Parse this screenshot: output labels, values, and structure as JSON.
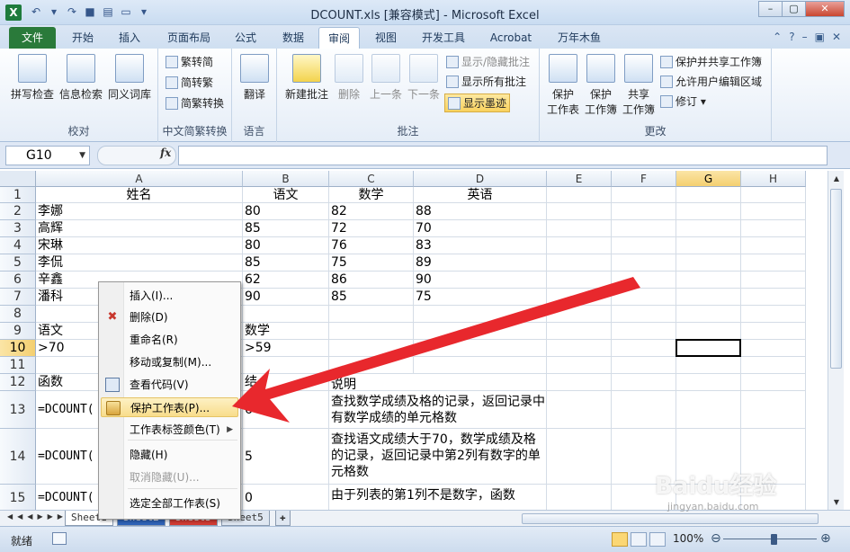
{
  "app": {
    "title": "DCOUNT.xls  [兼容模式] - Microsoft Excel",
    "logo": "X",
    "accent": "#2a7a3a"
  },
  "ribbon_tabs": [
    "文件",
    "开始",
    "插入",
    "页面布局",
    "公式",
    "数据",
    "审阅",
    "视图",
    "开发工具",
    "Acrobat",
    "万年木鱼"
  ],
  "active_tab": "审阅",
  "ribbon": {
    "proofing": {
      "spell": "拼写检查",
      "research": "信息检索",
      "thesaurus": "同义词库",
      "label": "校对"
    },
    "chinese": {
      "to_simplified": "繁转简",
      "to_traditional": "简转繁",
      "convert": "简繁转换",
      "label": "中文简繁转换"
    },
    "language": {
      "translate": "翻译",
      "label": "语言"
    },
    "comments": {
      "new": "新建批注",
      "delete": "删除",
      "prev": "上一条",
      "next": "下一条",
      "show_hide": "显示/隐藏批注",
      "show_all": "显示所有批注",
      "show_ink": "显示墨迹",
      "label": "批注"
    },
    "changes": {
      "protect_sheet_1": "保护",
      "protect_sheet_2": "工作表",
      "protect_book_1": "保护",
      "protect_book_2": "工作簿",
      "share_1": "共享",
      "share_2": "工作簿",
      "protect_share": "保护并共享工作簿",
      "allow_edit": "允许用户编辑区域",
      "track": "修订",
      "label": "更改"
    }
  },
  "formula_bar": {
    "name_box": "G10",
    "fx": "fx",
    "formula": ""
  },
  "columns": [
    "A",
    "B",
    "C",
    "D",
    "E",
    "F",
    "G",
    "H"
  ],
  "selected_column": "G",
  "rows": [
    "1",
    "2",
    "3",
    "4",
    "5",
    "6",
    "7",
    "8",
    "9",
    "10",
    "11",
    "12",
    "13",
    "14",
    "15"
  ],
  "selected_row": "10",
  "cells": {
    "A1": "姓名",
    "B1": "语文",
    "C1": "数学",
    "D1": "英语",
    "A2": "李娜",
    "B2": "80",
    "C2": "82",
    "D2": "88",
    "A3": "高辉",
    "B3": "85",
    "C3": "72",
    "D3": "70",
    "A4": "宋琳",
    "B4": "80",
    "C4": "76",
    "D4": "83",
    "A5": "李侃",
    "B5": "85",
    "C5": "75",
    "D5": "89",
    "A6": "辛鑫",
    "B6": "62",
    "C6": "86",
    "D6": "90",
    "A7": "潘科",
    "B7": "90",
    "C7": "85",
    "D7": "75",
    "A9": "语文",
    "B9": "数学",
    "A10": ">70",
    "B10": ">59",
    "A12": "函数",
    "B12": "结",
    "C12": "说明",
    "A13": "=DCOUNT(",
    "B13": "6",
    "C13": "查找数学成绩及格的记录，返回记录中有数学成绩的单元格数",
    "A14": "=DCOUNT(",
    "B14": "5",
    "C14": "查找语文成绩大于70，数学成绩及格的记录，返回记录中第2列有数字的单元格数",
    "A15": "=DCOUNT(",
    "B15": "0",
    "C15": "由于列表的第1列不是数字，函数"
  },
  "context_menu": [
    {
      "label": "插入(I)...",
      "icon": "",
      "enabled": true
    },
    {
      "label": "删除(D)",
      "icon": "delete-sheet-icon",
      "enabled": true
    },
    {
      "label": "重命名(R)",
      "icon": "",
      "enabled": true
    },
    {
      "label": "移动或复制(M)...",
      "icon": "",
      "enabled": true
    },
    {
      "label": "查看代码(V)",
      "icon": "view-code-icon",
      "enabled": true
    },
    {
      "label": "保护工作表(P)...",
      "icon": "protect-sheet-icon",
      "enabled": true,
      "highlighted": true
    },
    {
      "label": "工作表标签颜色(T)",
      "icon": "",
      "enabled": true,
      "submenu": true
    },
    {
      "label": "隐藏(H)",
      "icon": "",
      "enabled": true
    },
    {
      "label": "取消隐藏(U)...",
      "icon": "",
      "enabled": false
    },
    {
      "label": "选定全部工作表(S)",
      "icon": "",
      "enabled": true
    }
  ],
  "sheet_tabs": [
    {
      "name": "Sheet1",
      "style": "active"
    },
    {
      "name": "Sheet2",
      "style": "blue"
    },
    {
      "name": "Sheet3",
      "style": "red"
    },
    {
      "name": "Sheet5",
      "style": "normal"
    }
  ],
  "status": {
    "ready": "就绪",
    "zoom": "100%",
    "zoom_level": 100
  },
  "watermark": {
    "brand": "Baidu经验",
    "url": "jingyan.baidu.com"
  },
  "annotation_color": "#e8282d"
}
